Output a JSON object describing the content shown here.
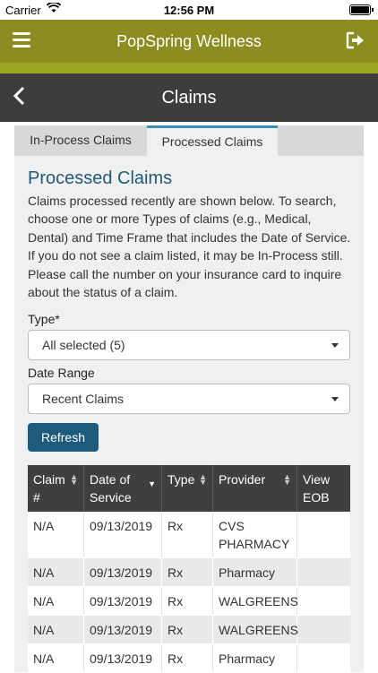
{
  "status_bar": {
    "carrier": "Carrier",
    "time": "12:56 PM"
  },
  "app": {
    "title": "PopSpring Wellness"
  },
  "page": {
    "title": "Claims"
  },
  "tabs": [
    {
      "label": "In-Process Claims"
    },
    {
      "label": "Processed Claims"
    }
  ],
  "section": {
    "heading": "Processed Claims",
    "description": "Claims processed recently are shown below. To search, choose one or more Types of claims (e.g., Medical, Dental) and Time Frame that includes the Date of Service. If you do not see a claim listed, it may be In-Process still. Please call the number on your insurance card to inquire about the status of a claim."
  },
  "filters": {
    "type_label": "Type*",
    "type_value": "All selected (5)",
    "date_label": "Date Range",
    "date_value": "Recent Claims"
  },
  "refresh_label": "Refresh",
  "table": {
    "headers": {
      "claim_line1": "Claim",
      "claim_line2": "#",
      "dos_line1": "Date of",
      "dos_line2": "Service",
      "type": "Type",
      "provider": "Provider",
      "eob_line1": "View",
      "eob_line2": "EOB"
    },
    "rows": [
      {
        "claim": "N/A",
        "date": "09/13/2019",
        "type": "Rx",
        "provider": "CVS PHARMACY",
        "eob": ""
      },
      {
        "claim": "N/A",
        "date": "09/13/2019",
        "type": "Rx",
        "provider": "Pharmacy",
        "eob": ""
      },
      {
        "claim": "N/A",
        "date": "09/13/2019",
        "type": "Rx",
        "provider": "WALGREENS",
        "eob": ""
      },
      {
        "claim": "N/A",
        "date": "09/13/2019",
        "type": "Rx",
        "provider": "WALGREENS",
        "eob": ""
      },
      {
        "claim": "N/A",
        "date": "09/13/2019",
        "type": "Rx",
        "provider": "Pharmacy",
        "eob": ""
      }
    ]
  }
}
